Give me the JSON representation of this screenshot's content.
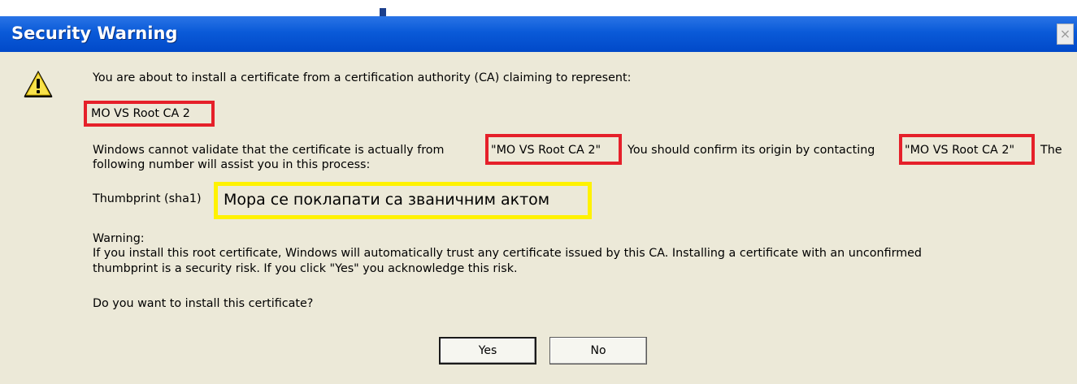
{
  "dialog": {
    "title": "Security Warning",
    "close_symbol": "×",
    "icon": "warning-icon",
    "intro": "You are about to install a certificate from a certification authority (CA) claiming to represent:",
    "ca_name": "MO VS Root CA 2",
    "validate_part1": "Windows cannot validate that the certificate is actually from",
    "validate_quoted_1": "\"MO VS Root CA 2\"",
    "validate_part2": "You should confirm its origin by contacting",
    "validate_quoted_2": "\"MO VS Root CA 2\"",
    "validate_part3": "The",
    "validate_line2": "following number will assist you in this process:",
    "thumbprint_label": "Thumbprint (sha1)",
    "thumbprint_value": "Мора се поклапати са званичним актом",
    "warning_heading": "Warning:",
    "warning_line1": "If you install this root certificate, Windows will automatically trust any certificate issued by this CA. Installing a certificate with an unconfirmed",
    "warning_line2": "thumbprint is a security risk. If you click \"Yes\" you acknowledge this risk.",
    "question": "Do you want to install this certificate?",
    "yes_label": "Yes",
    "no_label": "No"
  },
  "colors": {
    "titlebar": "#0a5ad8",
    "dialog_bg": "#ece9d8",
    "red_highlight": "#e5202a",
    "yellow_highlight": "#fff200"
  }
}
